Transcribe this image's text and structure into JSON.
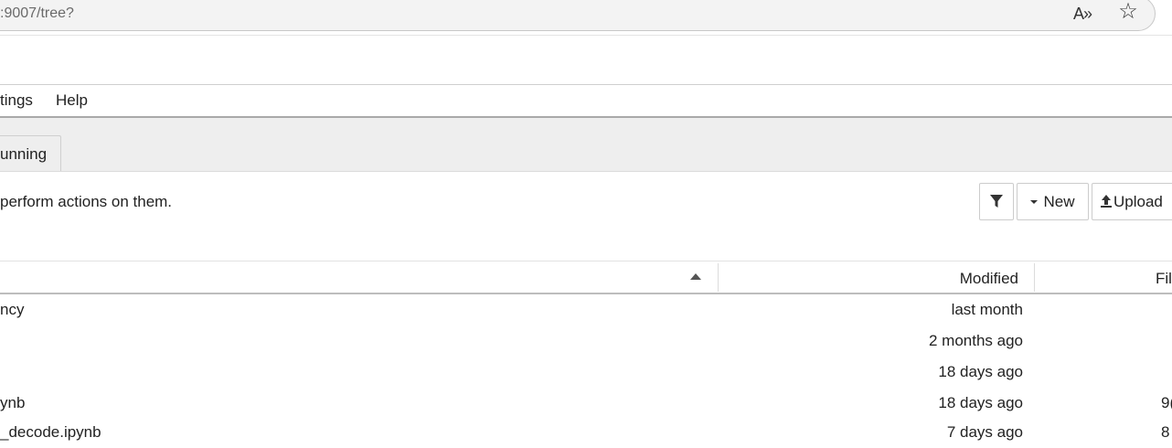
{
  "browser": {
    "url": ":9007/tree?",
    "read_aloud_icon": "A»",
    "favorite_icon": "☆"
  },
  "menu": {
    "items": [
      "tings",
      "Help"
    ]
  },
  "tabs": {
    "running_label": "unning"
  },
  "toolbar": {
    "instruction": "perform actions on them.",
    "filter_icon": "filter-icon",
    "new_label": "New",
    "upload_label": "Upload"
  },
  "table": {
    "headers": {
      "modified": "Modified",
      "file_size": "Fil"
    },
    "rows": [
      {
        "name": "ncy",
        "modified": "last month",
        "size": ""
      },
      {
        "name": "",
        "modified": "2 months ago",
        "size": ""
      },
      {
        "name": "",
        "modified": "18 days ago",
        "size": ""
      },
      {
        "name": "ynb",
        "modified": "18 days ago",
        "size": "9("
      },
      {
        "name": "_decode.ipynb",
        "modified": "7 days ago",
        "size": "8"
      }
    ]
  }
}
